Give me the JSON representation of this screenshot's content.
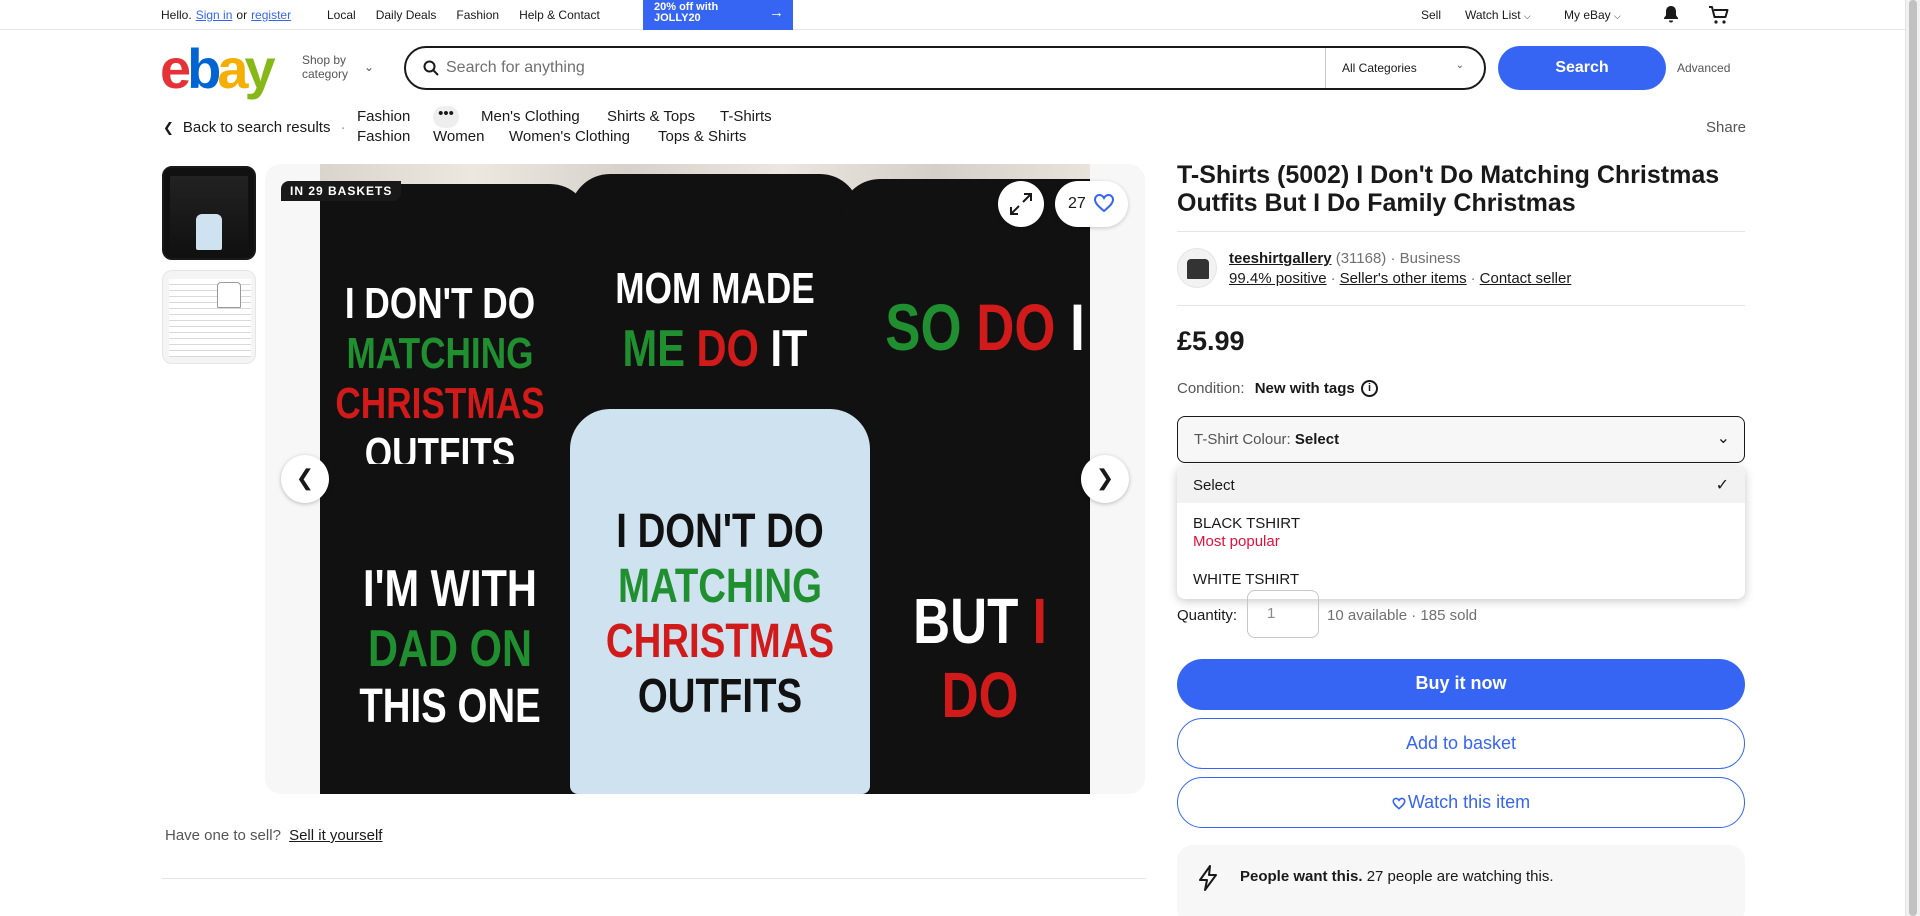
{
  "topbar": {
    "hello": "Hello.",
    "sign_in": "Sign in",
    "or": "or",
    "register": "register",
    "nav": [
      "Local",
      "Daily Deals",
      "Fashion",
      "Help & Contact"
    ],
    "promo_line1": "20% off with",
    "promo_line2": "JOLLY20",
    "sell": "Sell",
    "watch_list": "Watch List",
    "my_ebay": "My eBay"
  },
  "header": {
    "logo": {
      "e": "e",
      "b": "b",
      "a": "a",
      "y": "y"
    },
    "shop_by_line1": "Shop by",
    "shop_by_line2": "category",
    "search_placeholder": "Search for anything",
    "category": "All Categories",
    "search_button": "Search",
    "advanced": "Advanced"
  },
  "breadcrumb": {
    "back": "Back to search results",
    "row1": [
      "Fashion",
      "...",
      "Men's Clothing",
      "Shirts & Tops",
      "T-Shirts"
    ],
    "row2": [
      "Fashion",
      "Women",
      "Women's Clothing",
      "Tops & Shirts"
    ],
    "share": "Share"
  },
  "gallery": {
    "badge": "IN 29 BASKETS",
    "watchers": "27",
    "shirts": {
      "s1": [
        "I DON'T DO",
        "MATCHING",
        "CHRISTMAS",
        "OUTFITS"
      ],
      "s2": [
        "MOM MADE",
        "ME",
        "DO",
        "IT"
      ],
      "s3": [
        "SO",
        "DO",
        "I"
      ],
      "s4": [
        "I'M WITH",
        "DAD ON",
        "THIS ONE"
      ],
      "s5": [
        "I DON'T DO",
        "MATCHING",
        "CHRISTMAS",
        "OUTFITS"
      ],
      "s6": [
        "BUT",
        "I",
        "DO"
      ]
    }
  },
  "sell_prompt": {
    "question": "Have one to sell?",
    "link": "Sell it yourself"
  },
  "product": {
    "title": "T-Shirts (5002) I Don't Do Matching Christmas Outfits But I Do Family Christmas",
    "seller_name": "teeshirtgallery",
    "seller_count": "(31168)",
    "seller_type": "Business",
    "positive": "99.4% positive",
    "other_items": "Seller's other items",
    "contact": "Contact seller",
    "price": "£5.99",
    "condition_label": "Condition:",
    "condition_value": "New with tags",
    "colour_label": "T-Shirt Colour:",
    "colour_value": "Select",
    "options": [
      {
        "label": "Select"
      },
      {
        "label": "BLACK TSHIRT",
        "note": "Most popular"
      },
      {
        "label": "WHITE TSHIRT"
      }
    ],
    "quantity_label": "Quantity:",
    "quantity_value": "1",
    "available": "10 available",
    "sold": "185 sold",
    "buy_now": "Buy it now",
    "add_basket": "Add to basket",
    "watch_item": "Watch this item",
    "people_bold": "People want this.",
    "people_rest": "27 people are watching this."
  },
  "colors": {
    "accent": "#3665f3",
    "popular": "#e0103a"
  }
}
